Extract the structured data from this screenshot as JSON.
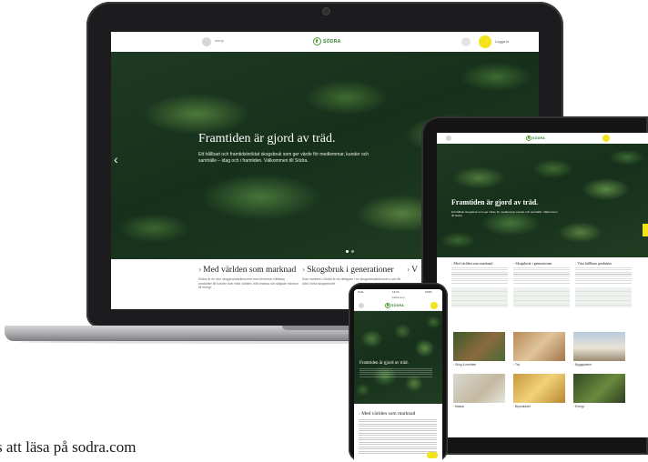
{
  "brand": {
    "name": "SÖDRA",
    "accent": "#4f9a34",
    "highlight": "#f4e21b"
  },
  "laptop": {
    "nav": {
      "menu_label": "meny",
      "user_label": "Logga in"
    },
    "hero": {
      "title": "Framtiden är gjord av träd.",
      "body": "Ett hållbart och framtidsinriktat skogsbruk som ger värde för medlemmar, kunder och samhälle – idag och i framtiden. Välkommen till Södra."
    },
    "cards": [
      {
        "title": "Med världen som marknad",
        "body": "Södra är en stor skogsindustrikoncern som levererar hållbara produkter till kunder över hela världen, från massa och sågade trävaror till energi."
      },
      {
        "title": "Skogsbruk i generationer",
        "body": "Som medlem i Södra är du delägare i en skogsindustrikoncern och får stöd i hela skogsbruket."
      },
      {
        "title": "V"
      }
    ]
  },
  "tablet": {
    "hero": {
      "title": "Framtiden är gjord av träd.",
      "body": "Ett hållbart skogsbruk som ger värde för medlemmar, kunder och samhälle. Välkommen till Södra."
    },
    "columns": [
      {
        "title": "Med världen som marknad"
      },
      {
        "title": "Skogsbruk i generationer"
      },
      {
        "title": "Våra hållbara produkter"
      }
    ],
    "tiles": [
      {
        "label": "Skog & medlem"
      },
      {
        "label": "Trä"
      },
      {
        "label": "Byggsystem"
      },
      {
        "label": "Massa"
      },
      {
        "label": "Biprodukter"
      },
      {
        "label": "Energi"
      }
    ]
  },
  "phone": {
    "status": {
      "carrier": "TeliA",
      "time": "13:24",
      "battery": "100%"
    },
    "url": "sodra.com",
    "hero": {
      "title": "Framtiden är gjord av träd."
    },
    "section_title": "Med världen som marknad"
  },
  "caption": "s att läsa på sodra.com"
}
